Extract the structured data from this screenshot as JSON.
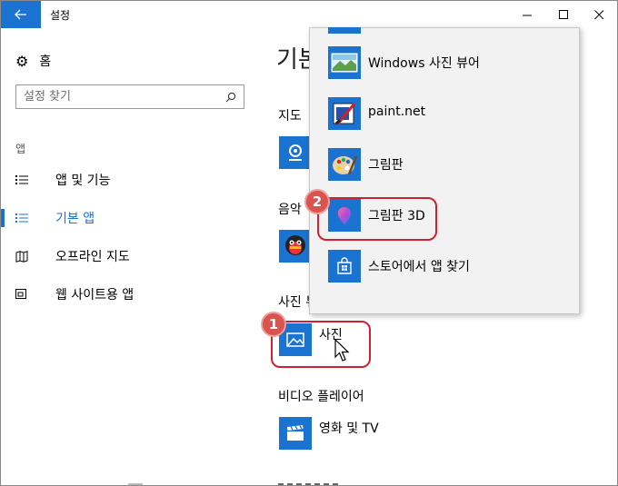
{
  "window": {
    "title": "설정"
  },
  "sidebar": {
    "home_label": "홈",
    "search_placeholder": "설정 찾기",
    "section_label": "앱",
    "items": [
      {
        "label": "앱 및 기능",
        "icon": "list-icon",
        "active": false
      },
      {
        "label": "기본 앱",
        "icon": "default-apps-icon",
        "active": true
      },
      {
        "label": "오프라인 지도",
        "icon": "map-icon",
        "active": false
      },
      {
        "label": "웹 사이트용 앱",
        "icon": "web-app-icon",
        "active": false
      }
    ]
  },
  "main": {
    "title": "기본",
    "sections": [
      {
        "heading": "지도"
      },
      {
        "heading": "음악"
      },
      {
        "heading": "사진 뷰"
      },
      {
        "heading": "비디오 플레이어",
        "app": "영화 및 TV"
      }
    ],
    "photo_app": "사진"
  },
  "popup": {
    "items": [
      {
        "label": "Windows 사진 뷰어",
        "icon": "windows-photo-viewer-icon"
      },
      {
        "label": "paint.net",
        "icon": "paint-net-icon"
      },
      {
        "label": "그림판",
        "icon": "paint-palette-icon"
      },
      {
        "label": "그림판 3D",
        "icon": "paint-3d-icon"
      },
      {
        "label": "스토어에서 앱 찾기",
        "icon": "store-icon"
      }
    ]
  },
  "annotations": {
    "badge1": "1",
    "badge2": "2"
  },
  "colors": {
    "accent": "#1a73d0",
    "callout": "#cc2233"
  }
}
